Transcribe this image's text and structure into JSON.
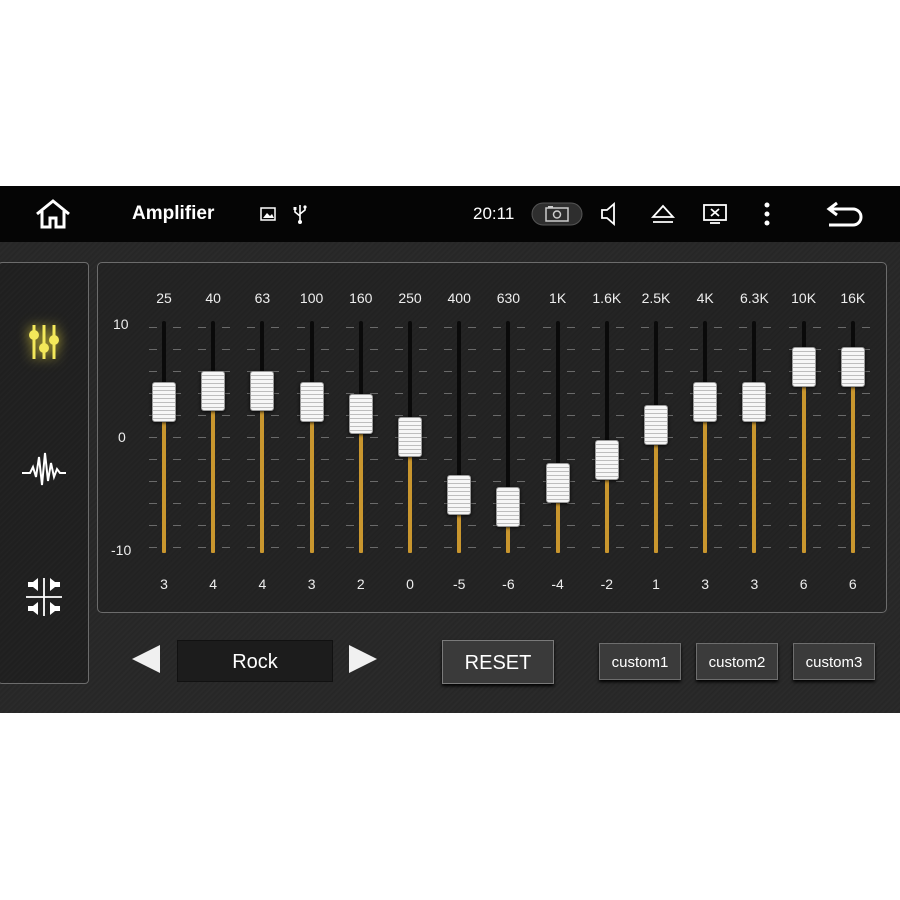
{
  "statusbar": {
    "title": "Amplifier",
    "time": "20:11",
    "icons": [
      "home-icon",
      "image-icon",
      "usb-icon",
      "screenshot-icon",
      "volume-icon",
      "eject-icon",
      "display-off-icon",
      "more-vert-icon",
      "back-icon"
    ]
  },
  "sidebar": {
    "items": [
      {
        "icon": "equalizer-icon",
        "active": true
      },
      {
        "icon": "sound-wave-icon",
        "active": false
      },
      {
        "icon": "balance-fader-icon",
        "active": false
      }
    ],
    "active_color": "#e8d94a"
  },
  "equalizer": {
    "scale": {
      "max_label": "10",
      "mid_label": "0",
      "min_label": "-10",
      "min": -10,
      "max": 10
    },
    "bands": [
      {
        "freq": "25",
        "value": 3,
        "value_label": "3"
      },
      {
        "freq": "40",
        "value": 4,
        "value_label": "4"
      },
      {
        "freq": "63",
        "value": 4,
        "value_label": "4"
      },
      {
        "freq": "100",
        "value": 3,
        "value_label": "3"
      },
      {
        "freq": "160",
        "value": 2,
        "value_label": "2"
      },
      {
        "freq": "250",
        "value": 0,
        "value_label": "0"
      },
      {
        "freq": "400",
        "value": -5,
        "value_label": "-5"
      },
      {
        "freq": "630",
        "value": -6,
        "value_label": "-6"
      },
      {
        "freq": "1K",
        "value": -4,
        "value_label": "-4"
      },
      {
        "freq": "1.6K",
        "value": -2,
        "value_label": "-2"
      },
      {
        "freq": "2.5K",
        "value": 1,
        "value_label": "1"
      },
      {
        "freq": "4K",
        "value": 3,
        "value_label": "3"
      },
      {
        "freq": "6.3K",
        "value": 3,
        "value_label": "3"
      },
      {
        "freq": "10K",
        "value": 6,
        "value_label": "6"
      },
      {
        "freq": "16K",
        "value": 6,
        "value_label": "6"
      }
    ],
    "fill_color": "#c9962e"
  },
  "controls": {
    "preset": "Rock",
    "reset_label": "RESET",
    "custom_labels": [
      "custom1",
      "custom2",
      "custom3"
    ]
  }
}
